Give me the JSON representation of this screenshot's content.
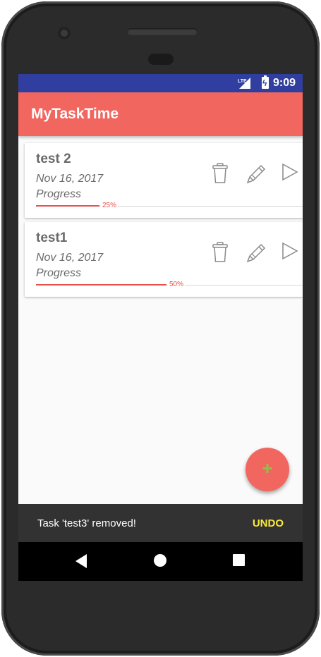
{
  "status_bar": {
    "network": "LTE",
    "time": "9:09"
  },
  "app": {
    "title": "MyTaskTime"
  },
  "tasks": [
    {
      "name": "test 2",
      "date": "Nov 16, 2017",
      "status": "Progress",
      "progress": 25,
      "progress_label": "25%"
    },
    {
      "name": "test1",
      "date": "Nov 16, 2017",
      "status": "Progress",
      "progress": 50,
      "progress_label": "50%"
    }
  ],
  "fab": {
    "symbol": "+",
    "icon": "add-icon"
  },
  "snackbar": {
    "message": "Task 'test3' removed!",
    "action": "UNDO"
  },
  "colors": {
    "primary": "#f26660",
    "status_bar": "#303f9f",
    "progress": "#e8504a",
    "snackbar_action": "#ffeb3b",
    "fab_icon": "#8bc34a"
  }
}
